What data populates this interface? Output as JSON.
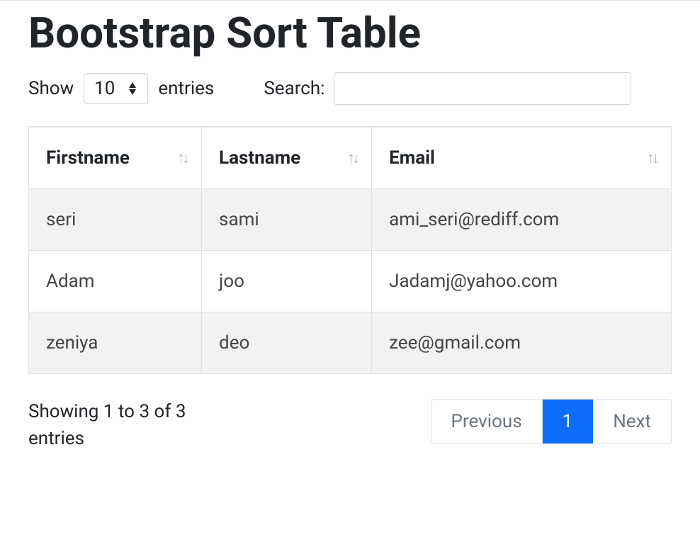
{
  "title": "Bootstrap Sort Table",
  "length": {
    "show_label": "Show",
    "entries_label": "entries",
    "value": "10"
  },
  "search": {
    "label": "Search:",
    "value": ""
  },
  "columns": [
    "Firstname",
    "Lastname",
    "Email"
  ],
  "rows": [
    {
      "firstname": "seri",
      "lastname": "sami",
      "email": "ami_seri@rediff.com"
    },
    {
      "firstname": "Adam",
      "lastname": "joo",
      "email": "Jadamj@yahoo.com"
    },
    {
      "firstname": "zeniya",
      "lastname": "deo",
      "email": "zee@gmail.com"
    }
  ],
  "info": "Showing 1 to 3 of 3 entries",
  "pagination": {
    "previous": "Previous",
    "next": "Next",
    "current": "1"
  }
}
